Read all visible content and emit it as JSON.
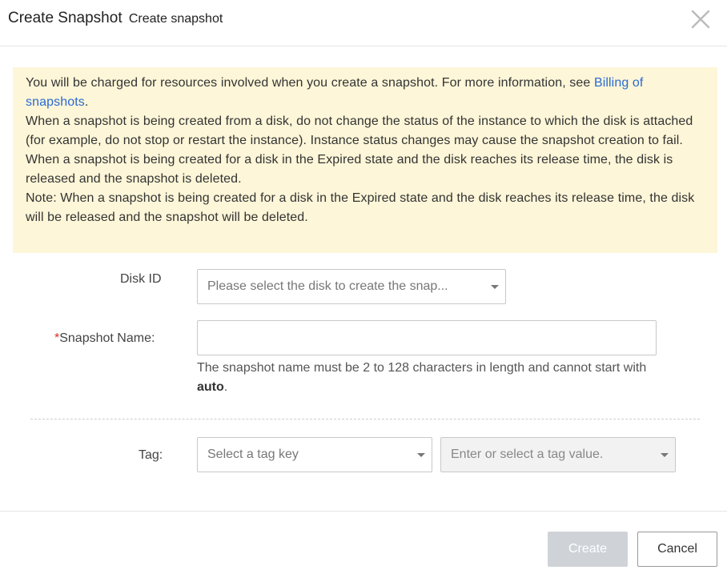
{
  "dialog": {
    "title": "Create Snapshot",
    "subtitle": "Create snapshot",
    "close_icon": "close-icon"
  },
  "notice": {
    "line1_prefix": "You will be charged for resources involved when you create a snapshot. For more information, see ",
    "line1_link": "Billing of snapshots",
    "line1_suffix": ".",
    "line2": "When a snapshot is being created from a disk, do not change the status of the instance to which the disk is attached (for example, do not stop or restart the instance). Instance status changes may cause the snapshot creation to fail.",
    "line3": "When a snapshot is being created for a disk in the Expired state and the disk reaches its release time, the disk is released and the snapshot is deleted.",
    "line4": "Note: When a snapshot is being created for a disk in the Expired state and the disk reaches its release time, the disk will be released and the snapshot will be deleted."
  },
  "form": {
    "disk_id_label": "Disk ID",
    "disk_id_placeholder": "Please select the disk to create the snap...",
    "required_mark": "*",
    "snapshot_name_label": "Snapshot Name:",
    "snapshot_name_value": "",
    "hint_prefix": "The snapshot name must be 2 to 128 characters in length and cannot start with ",
    "hint_bold": "auto",
    "hint_suffix": ".",
    "tag_label": "Tag:",
    "tag_key_placeholder": "Select a tag key",
    "tag_value_placeholder": "Enter or select a tag value."
  },
  "footer": {
    "create_label": "Create",
    "cancel_label": "Cancel"
  },
  "colors": {
    "notice_bg": "#fdf6d8",
    "link": "#2a6ad3",
    "required": "#d93026",
    "create_disabled": "#cfd3d8"
  }
}
